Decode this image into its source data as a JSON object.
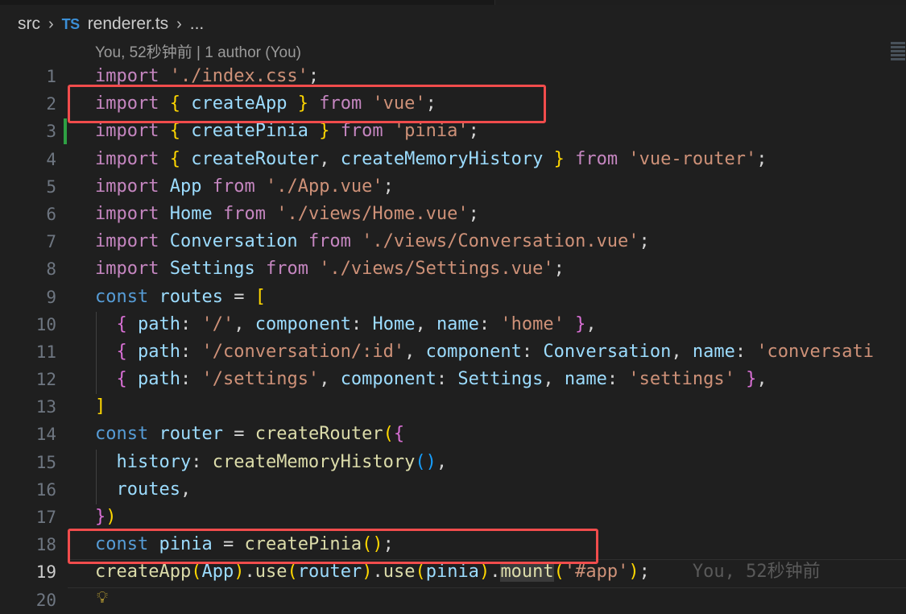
{
  "breadcrumb": {
    "folder": "src",
    "file_icon": "TS",
    "file": "renderer.ts",
    "more": "..."
  },
  "blame": {
    "text": "You, 52秒钟前 | 1 author (You)"
  },
  "lines": [
    {
      "n": "1",
      "tokens": [
        [
          "k",
          "import"
        ],
        [
          "p",
          " "
        ],
        [
          "s",
          "'./index.css'"
        ],
        [
          "p",
          ";"
        ]
      ]
    },
    {
      "n": "2",
      "tokens": [
        [
          "k",
          "import"
        ],
        [
          "p",
          " "
        ],
        [
          "b1",
          "{"
        ],
        [
          "p",
          " "
        ],
        [
          "v",
          "createApp"
        ],
        [
          "p",
          " "
        ],
        [
          "b1",
          "}"
        ],
        [
          "p",
          " "
        ],
        [
          "k",
          "from"
        ],
        [
          "p",
          " "
        ],
        [
          "s",
          "'vue'"
        ],
        [
          "p",
          ";"
        ]
      ]
    },
    {
      "n": "3",
      "tokens": [
        [
          "k",
          "import"
        ],
        [
          "p",
          " "
        ],
        [
          "b1",
          "{"
        ],
        [
          "p",
          " "
        ],
        [
          "v",
          "createPinia"
        ],
        [
          "p",
          " "
        ],
        [
          "b1",
          "}"
        ],
        [
          "p",
          " "
        ],
        [
          "k",
          "from"
        ],
        [
          "p",
          " "
        ],
        [
          "s",
          "'pinia'"
        ],
        [
          "p",
          ";"
        ]
      ]
    },
    {
      "n": "4",
      "tokens": [
        [
          "k",
          "import"
        ],
        [
          "p",
          " "
        ],
        [
          "b1",
          "{"
        ],
        [
          "p",
          " "
        ],
        [
          "v",
          "createRouter"
        ],
        [
          "p",
          ", "
        ],
        [
          "v",
          "createMemoryHistory"
        ],
        [
          "p",
          " "
        ],
        [
          "b1",
          "}"
        ],
        [
          "p",
          " "
        ],
        [
          "k",
          "from"
        ],
        [
          "p",
          " "
        ],
        [
          "s",
          "'vue-router'"
        ],
        [
          "p",
          ";"
        ]
      ]
    },
    {
      "n": "5",
      "tokens": [
        [
          "k",
          "import"
        ],
        [
          "p",
          " "
        ],
        [
          "v",
          "App"
        ],
        [
          "p",
          " "
        ],
        [
          "k",
          "from"
        ],
        [
          "p",
          " "
        ],
        [
          "s",
          "'./App.vue'"
        ],
        [
          "p",
          ";"
        ]
      ]
    },
    {
      "n": "6",
      "tokens": [
        [
          "k",
          "import"
        ],
        [
          "p",
          " "
        ],
        [
          "v",
          "Home"
        ],
        [
          "p",
          " "
        ],
        [
          "k",
          "from"
        ],
        [
          "p",
          " "
        ],
        [
          "s",
          "'./views/Home.vue'"
        ],
        [
          "p",
          ";"
        ]
      ]
    },
    {
      "n": "7",
      "tokens": [
        [
          "k",
          "import"
        ],
        [
          "p",
          " "
        ],
        [
          "v",
          "Conversation"
        ],
        [
          "p",
          " "
        ],
        [
          "k",
          "from"
        ],
        [
          "p",
          " "
        ],
        [
          "s",
          "'./views/Conversation.vue'"
        ],
        [
          "p",
          ";"
        ]
      ]
    },
    {
      "n": "8",
      "tokens": [
        [
          "k",
          "import"
        ],
        [
          "p",
          " "
        ],
        [
          "v",
          "Settings"
        ],
        [
          "p",
          " "
        ],
        [
          "k",
          "from"
        ],
        [
          "p",
          " "
        ],
        [
          "s",
          "'./views/Settings.vue'"
        ],
        [
          "p",
          ";"
        ]
      ]
    },
    {
      "n": "9",
      "tokens": [
        [
          "kw",
          "const"
        ],
        [
          "p",
          " "
        ],
        [
          "v",
          "routes"
        ],
        [
          "p",
          " = "
        ],
        [
          "b1",
          "["
        ]
      ]
    },
    {
      "n": "10",
      "tokens": [
        [
          "p",
          "  "
        ],
        [
          "b2",
          "{"
        ],
        [
          "p",
          " "
        ],
        [
          "v",
          "path"
        ],
        [
          "p",
          ": "
        ],
        [
          "s",
          "'/'"
        ],
        [
          "p",
          ", "
        ],
        [
          "v",
          "component"
        ],
        [
          "p",
          ": "
        ],
        [
          "v",
          "Home"
        ],
        [
          "p",
          ", "
        ],
        [
          "v",
          "name"
        ],
        [
          "p",
          ": "
        ],
        [
          "s",
          "'home'"
        ],
        [
          "p",
          " "
        ],
        [
          "b2",
          "}"
        ],
        [
          "p",
          ","
        ]
      ]
    },
    {
      "n": "11",
      "tokens": [
        [
          "p",
          "  "
        ],
        [
          "b2",
          "{"
        ],
        [
          "p",
          " "
        ],
        [
          "v",
          "path"
        ],
        [
          "p",
          ": "
        ],
        [
          "s",
          "'/conversation/:id'"
        ],
        [
          "p",
          ", "
        ],
        [
          "v",
          "component"
        ],
        [
          "p",
          ": "
        ],
        [
          "v",
          "Conversation"
        ],
        [
          "p",
          ", "
        ],
        [
          "v",
          "name"
        ],
        [
          "p",
          ": "
        ],
        [
          "s",
          "'conversati"
        ]
      ]
    },
    {
      "n": "12",
      "tokens": [
        [
          "p",
          "  "
        ],
        [
          "b2",
          "{"
        ],
        [
          "p",
          " "
        ],
        [
          "v",
          "path"
        ],
        [
          "p",
          ": "
        ],
        [
          "s",
          "'/settings'"
        ],
        [
          "p",
          ", "
        ],
        [
          "v",
          "component"
        ],
        [
          "p",
          ": "
        ],
        [
          "v",
          "Settings"
        ],
        [
          "p",
          ", "
        ],
        [
          "v",
          "name"
        ],
        [
          "p",
          ": "
        ],
        [
          "s",
          "'settings'"
        ],
        [
          "p",
          " "
        ],
        [
          "b2",
          "}"
        ],
        [
          "p",
          ","
        ]
      ]
    },
    {
      "n": "13",
      "tokens": [
        [
          "b1",
          "]"
        ]
      ]
    },
    {
      "n": "14",
      "tokens": [
        [
          "kw",
          "const"
        ],
        [
          "p",
          " "
        ],
        [
          "v",
          "router"
        ],
        [
          "p",
          " = "
        ],
        [
          "f",
          "createRouter"
        ],
        [
          "b1",
          "("
        ],
        [
          "b2",
          "{"
        ]
      ]
    },
    {
      "n": "15",
      "tokens": [
        [
          "p",
          "  "
        ],
        [
          "v",
          "history"
        ],
        [
          "p",
          ": "
        ],
        [
          "f",
          "createMemoryHistory"
        ],
        [
          "b3",
          "()"
        ],
        [
          "p",
          ","
        ]
      ]
    },
    {
      "n": "16",
      "tokens": [
        [
          "p",
          "  "
        ],
        [
          "v",
          "routes"
        ],
        [
          "p",
          ","
        ]
      ]
    },
    {
      "n": "17",
      "tokens": [
        [
          "b2",
          "}"
        ],
        [
          "b1",
          ")"
        ]
      ]
    },
    {
      "n": "18",
      "tokens": [
        [
          "kw",
          "const"
        ],
        [
          "p",
          " "
        ],
        [
          "v",
          "pinia"
        ],
        [
          "p",
          " = "
        ],
        [
          "f",
          "createPinia"
        ],
        [
          "b1",
          "()"
        ],
        [
          "p",
          ";"
        ]
      ]
    },
    {
      "n": "19",
      "active": true,
      "tokens": [
        [
          "f",
          "createApp"
        ],
        [
          "b1",
          "("
        ],
        [
          "v",
          "App"
        ],
        [
          "b1",
          ")"
        ],
        [
          "p",
          "."
        ],
        [
          "f",
          "use"
        ],
        [
          "b1",
          "("
        ],
        [
          "v",
          "router"
        ],
        [
          "b1",
          ")"
        ],
        [
          "p",
          "."
        ],
        [
          "f",
          "use"
        ],
        [
          "b1",
          "("
        ],
        [
          "v",
          "pinia"
        ],
        [
          "b1",
          ")"
        ],
        [
          "p",
          "."
        ],
        [
          "mount",
          "mount"
        ],
        [
          "b1",
          "("
        ],
        [
          "s",
          "'#app'"
        ],
        [
          "b1",
          ")"
        ],
        [
          "p",
          ";"
        ],
        [
          "p",
          "    "
        ],
        [
          "ghost",
          "You, 52秒钟前"
        ]
      ]
    },
    {
      "n": "20",
      "tokens": []
    }
  ],
  "colors": {
    "editor_bg": "#1f1f1f",
    "keyword": "#c586c0",
    "string": "#ce9178",
    "variable": "#9cdcfe",
    "function": "#dcdcaa",
    "storage": "#569cd6",
    "highlight_box": "#f14c4c",
    "git_added": "#2ea043"
  },
  "icons": {
    "chevron": "chevron-right-icon",
    "lightbulb": "lightbulb-icon"
  }
}
